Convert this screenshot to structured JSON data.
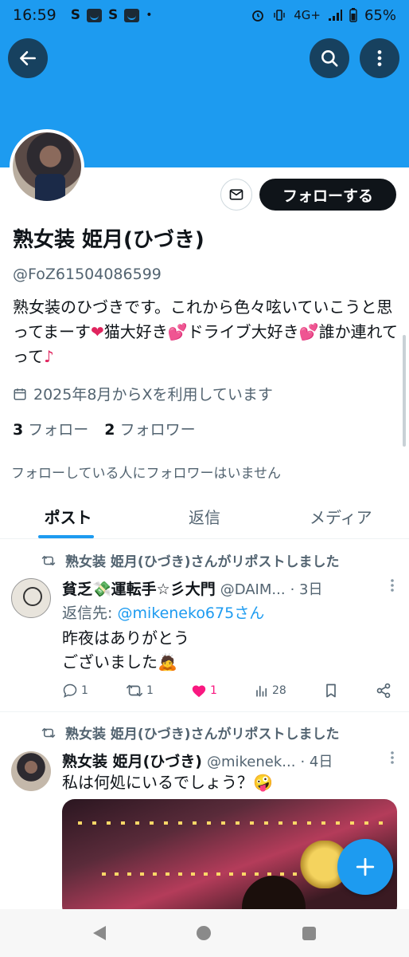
{
  "status_bar": {
    "time": "16:59",
    "app1": "S",
    "app2": "S",
    "dot": "•",
    "network": "4G+",
    "battery": "65%"
  },
  "profile": {
    "name": "熟女装 姫月(ひづき)",
    "handle": "@FoZ61504086599",
    "bio_parts": [
      "熟女装のひづきです。これから色々呟いていこうと思ってまーす",
      "❤",
      "猫大好き",
      "💕",
      "ドライブ大好き",
      "💕",
      "誰か連れてって",
      "♪"
    ],
    "joined": "2025年8月からXを利用しています",
    "following_count": "3",
    "following_label": "フォロー",
    "followers_count": "2",
    "followers_label": "フォロワー",
    "no_mutual": "フォローしている人にフォロワーはいません",
    "follow_button": "フォローする"
  },
  "tabs": [
    {
      "label": "ポスト",
      "active": true
    },
    {
      "label": "返信",
      "active": false
    },
    {
      "label": "メディア",
      "active": false
    }
  ],
  "tweets": [
    {
      "repost_label": "熟女装 姫月(ひづき)さんがリポストしました",
      "author_name": "貧乏💸運転手☆彡大門",
      "author_handle": "@DAIM...",
      "time": "· 3日",
      "reply_prefix": "返信先: ",
      "reply_to": "@mikeneko675さん",
      "text_line1": "昨夜はありがとう",
      "text_line2": "ございました🙇",
      "replies": "1",
      "reposts": "1",
      "likes": "1",
      "views": "28"
    },
    {
      "repost_label": "熟女装 姫月(ひづき)さんがリポストしました",
      "author_name": "熟女装 姫月(ひづき)",
      "author_handle": "@mikenek...",
      "time": "· 4日",
      "text_line1": "私は何処にいるでしょう？🤪"
    }
  ],
  "colors": {
    "accent": "#1d9bf0",
    "text": "#0f1419",
    "muted": "#536471",
    "like": "#f91880"
  },
  "icons": {
    "back": "arrow-left-icon",
    "search": "search-icon",
    "more": "more-vertical-icon",
    "mail": "mail-icon",
    "calendar": "calendar-icon",
    "repost": "repost-icon",
    "reply": "reply-icon",
    "like": "heart-icon",
    "views": "views-icon",
    "bookmark": "bookmark-icon",
    "share": "share-icon",
    "compose": "plus-icon"
  }
}
